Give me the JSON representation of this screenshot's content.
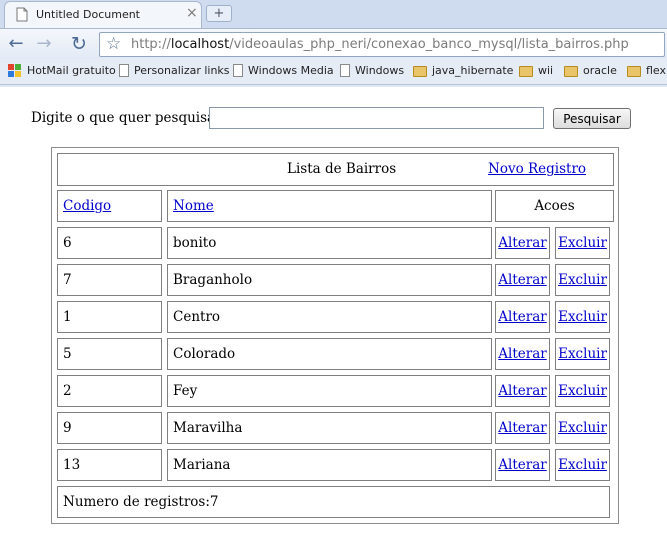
{
  "browser": {
    "tab_title": "Untitled Document",
    "close_icon": "×",
    "new_tab_icon": "+",
    "url_scheme": "http://",
    "url_host": "localhost",
    "url_path": "/videoaulas_php_neri/conexao_banco_mysql/lista_bairros.php",
    "bookmarks": [
      {
        "label": "HotMail gratuito",
        "icon": "msn-icon"
      },
      {
        "label": "Personalizar links",
        "icon": "page-icon"
      },
      {
        "label": "Windows Media",
        "icon": "page-icon"
      },
      {
        "label": "Windows",
        "icon": "page-icon"
      },
      {
        "label": "java_hibernate",
        "icon": "folder-icon"
      },
      {
        "label": "wii",
        "icon": "folder-icon"
      },
      {
        "label": "oracle",
        "icon": "folder-icon"
      },
      {
        "label": "flex",
        "icon": "folder-icon"
      }
    ]
  },
  "search": {
    "label": "Digite o que quer pesquisar.:",
    "value": "",
    "button_label": "Pesquisar"
  },
  "table": {
    "title": "Lista de Bairros",
    "new_record_link": "Novo Registro",
    "headers": {
      "codigo": "Codigo",
      "nome": "Nome",
      "acoes": "Acoes"
    },
    "rows": [
      {
        "codigo": "6",
        "nome": "bonito",
        "alterar": "Alterar",
        "excluir": "Excluir"
      },
      {
        "codigo": "7",
        "nome": "Braganholo",
        "alterar": "Alterar",
        "excluir": "Excluir"
      },
      {
        "codigo": "1",
        "nome": "Centro",
        "alterar": "Alterar",
        "excluir": "Excluir"
      },
      {
        "codigo": "5",
        "nome": "Colorado",
        "alterar": "Alterar",
        "excluir": "Excluir"
      },
      {
        "codigo": "2",
        "nome": "Fey",
        "alterar": "Alterar",
        "excluir": "Excluir"
      },
      {
        "codigo": "9",
        "nome": "Maravilha",
        "alterar": "Alterar",
        "excluir": "Excluir"
      },
      {
        "codigo": "13",
        "nome": "Mariana",
        "alterar": "Alterar",
        "excluir": "Excluir"
      }
    ],
    "footer": "Numero de registros:7"
  },
  "colors": {
    "link": "#0000cc",
    "border": "#808080",
    "chrome": "#dfe7f3"
  }
}
